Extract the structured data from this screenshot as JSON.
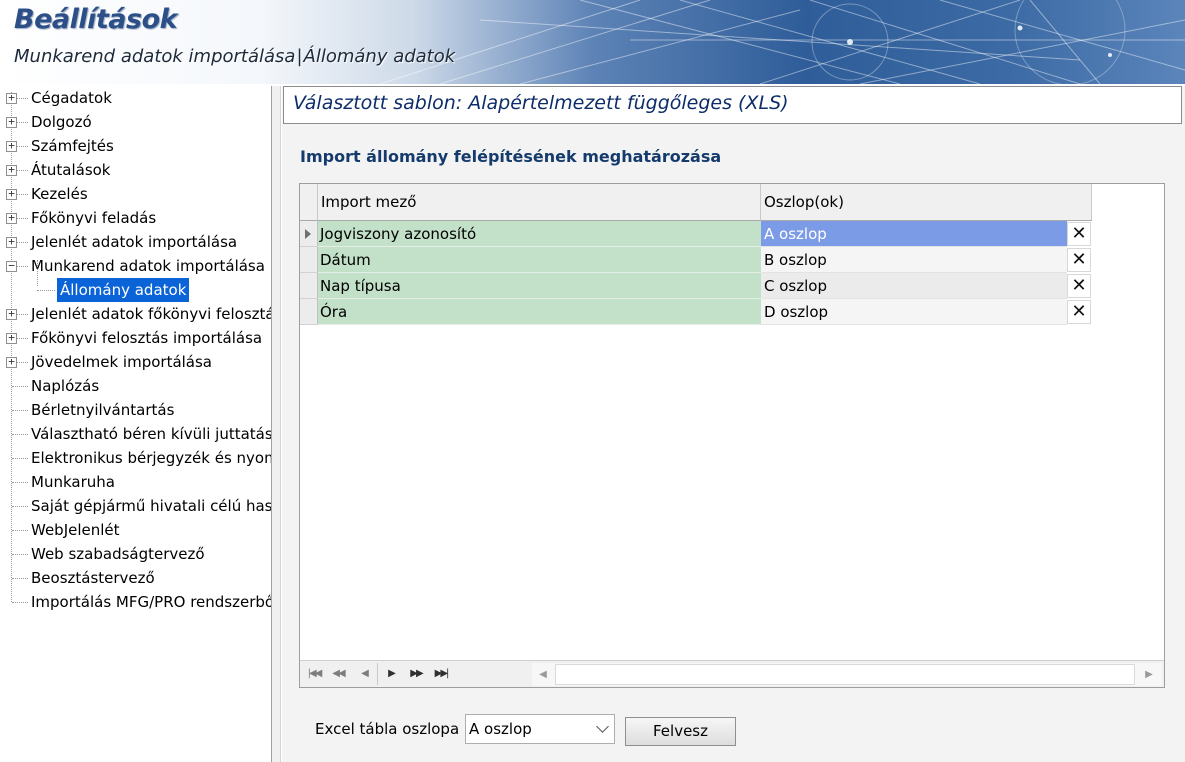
{
  "header": {
    "app_title": "Beállítások",
    "crumb_parent": "Munkarend adatok importálása",
    "crumb_separator": "|",
    "crumb_current": "Állomány adatok"
  },
  "tree": {
    "items": [
      {
        "label": "Cégadatok",
        "expandable": true
      },
      {
        "label": "Dolgozó",
        "expandable": true
      },
      {
        "label": "Számfejtés",
        "expandable": true
      },
      {
        "label": "Átutalások",
        "expandable": true
      },
      {
        "label": "Kezelés",
        "expandable": true
      },
      {
        "label": "Főkönyvi feladás",
        "expandable": true
      },
      {
        "label": "Jelenlét adatok importálása",
        "expandable": true
      },
      {
        "label": "Munkarend adatok importálása",
        "expandable": true,
        "expanded": true
      },
      {
        "label": "Állomány adatok",
        "child": true,
        "selected": true
      },
      {
        "label": "Jelenlét adatok főkönyvi felosztá",
        "expandable": true
      },
      {
        "label": "Főkönyvi felosztás importálása",
        "expandable": true
      },
      {
        "label": "Jövedelmek importálása",
        "expandable": true
      },
      {
        "label": "Naplózás"
      },
      {
        "label": "Bérletnyilvántartás"
      },
      {
        "label": "Választható béren kívüli juttatás"
      },
      {
        "label": "Elektronikus bérjegyzék és nyom"
      },
      {
        "label": "Munkaruha"
      },
      {
        "label": "Saját gépjármű hivatali célú hasz"
      },
      {
        "label": "WebJelenlét"
      },
      {
        "label": "Web szabadságtervező"
      },
      {
        "label": "Beosztástervező"
      },
      {
        "label": "Importálás MFG/PRO rendszerbő"
      }
    ]
  },
  "panel": {
    "template_title": "Választott sablon: Alapértelmezett függőleges (XLS)",
    "section_title": "Import állomány felépítésének meghatározása",
    "grid": {
      "columns": [
        "Import mező",
        "Oszlop(ok)"
      ],
      "rows": [
        {
          "field": "Jogviszony azonosító",
          "column": "A oszlop"
        },
        {
          "field": "Dátum",
          "column": "B oszlop"
        },
        {
          "field": "Nap típusa",
          "column": "C oszlop"
        },
        {
          "field": "Óra",
          "column": "D oszlop"
        }
      ],
      "delete_glyph": "✕"
    },
    "bottom": {
      "excel_label": "Excel tábla oszlopa",
      "excel_selected": "A oszlop",
      "add_button": "Felvesz"
    }
  },
  "colors": {
    "accent": "#0a64d8",
    "field_cell": "#c3e0c8",
    "active_cell": "#7c9be6",
    "title_text": "#0d2d6a"
  }
}
